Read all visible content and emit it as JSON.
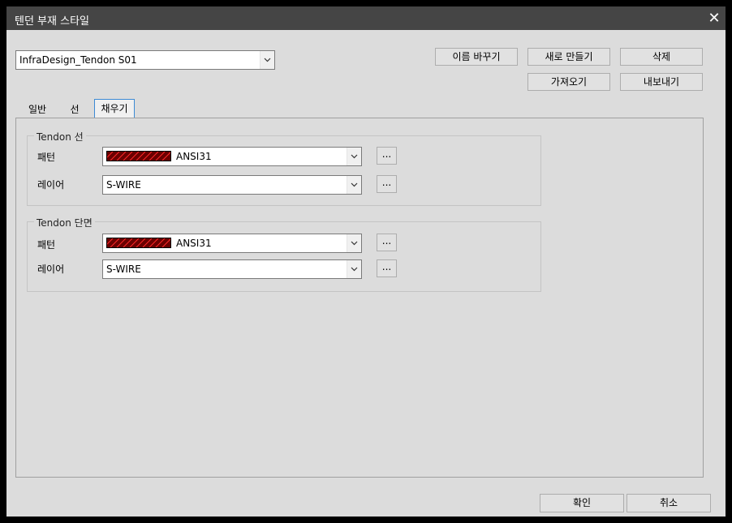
{
  "window": {
    "title": "텐던 부재 스타일",
    "close": "✕"
  },
  "style_select": {
    "value": "InfraDesign_Tendon S01"
  },
  "buttons": {
    "rename": "이름 바꾸기",
    "new": "새로 만들기",
    "delete": "삭제",
    "import": "가져오기",
    "export": "내보내기",
    "ok": "확인",
    "cancel": "취소"
  },
  "tabs": [
    {
      "label": "일반"
    },
    {
      "label": "선"
    },
    {
      "label": "채우기",
      "active": true
    }
  ],
  "groups": {
    "line": {
      "title": "Tendon 선",
      "pattern_label": "패턴",
      "pattern_value": "ANSI31",
      "layer_label": "레이어",
      "layer_value": "S-WIRE",
      "ellipsis": "..."
    },
    "section": {
      "title": "Tendon 단면",
      "pattern_label": "패턴",
      "pattern_value": "ANSI31",
      "layer_label": "레이어",
      "layer_value": "S-WIRE",
      "ellipsis": "..."
    }
  },
  "colors": {
    "titlebar": "#454545",
    "dialog_bg": "#dcdcdc",
    "hatch_bg": "#6a0000",
    "hatch_line": "#ff2a2a",
    "tab_active_border": "#3c8ad4"
  }
}
